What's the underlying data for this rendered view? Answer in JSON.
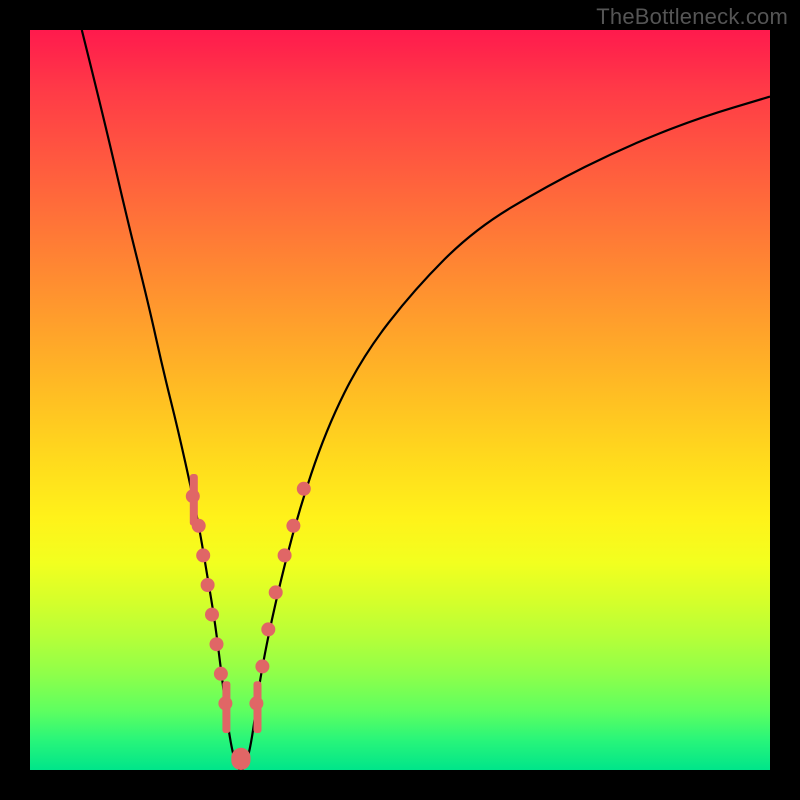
{
  "watermark": "TheBottleneck.com",
  "colors": {
    "curve": "#000000",
    "dots": "#e06666",
    "gradient_top": "#ff1a4d",
    "gradient_bottom": "#00e58a",
    "frame": "#000000"
  },
  "chart_data": {
    "type": "line",
    "title": "",
    "xlabel": "",
    "ylabel": "",
    "xlim": [
      0,
      100
    ],
    "ylim": [
      0,
      100
    ],
    "grid": false,
    "legend": false,
    "series": [
      {
        "name": "curve",
        "x": [
          7,
          10,
          13,
          16,
          18,
          20,
          22,
          23,
          24,
          25,
          26,
          27,
          28,
          29,
          30,
          31,
          33,
          36,
          40,
          45,
          52,
          60,
          70,
          80,
          90,
          100
        ],
        "y": [
          100,
          88,
          75,
          63,
          54,
          46,
          37,
          32,
          26,
          20,
          12,
          4,
          0,
          0,
          4,
          12,
          22,
          34,
          46,
          56,
          65,
          73,
          79,
          84,
          88,
          91
        ]
      }
    ],
    "annotations": {
      "dots_on_curve": [
        {
          "x": 22.0,
          "y": 37
        },
        {
          "x": 22.8,
          "y": 33
        },
        {
          "x": 23.4,
          "y": 29
        },
        {
          "x": 24.0,
          "y": 25
        },
        {
          "x": 24.6,
          "y": 21
        },
        {
          "x": 25.2,
          "y": 17
        },
        {
          "x": 25.8,
          "y": 13
        },
        {
          "x": 26.4,
          "y": 9
        },
        {
          "x": 30.6,
          "y": 9
        },
        {
          "x": 31.4,
          "y": 14
        },
        {
          "x": 32.2,
          "y": 19
        },
        {
          "x": 33.2,
          "y": 24
        },
        {
          "x": 34.4,
          "y": 29
        },
        {
          "x": 35.6,
          "y": 33
        },
        {
          "x": 37.0,
          "y": 38
        }
      ],
      "pills": [
        {
          "x0": 21.6,
          "x1": 22.4,
          "y0": 33,
          "y1": 40
        },
        {
          "x0": 26.0,
          "x1": 26.8,
          "y0": 5,
          "y1": 12
        },
        {
          "x0": 27.2,
          "x1": 29.8,
          "y0": 0,
          "y1": 3
        },
        {
          "x0": 30.2,
          "x1": 31.0,
          "y0": 5,
          "y1": 12
        }
      ]
    }
  }
}
